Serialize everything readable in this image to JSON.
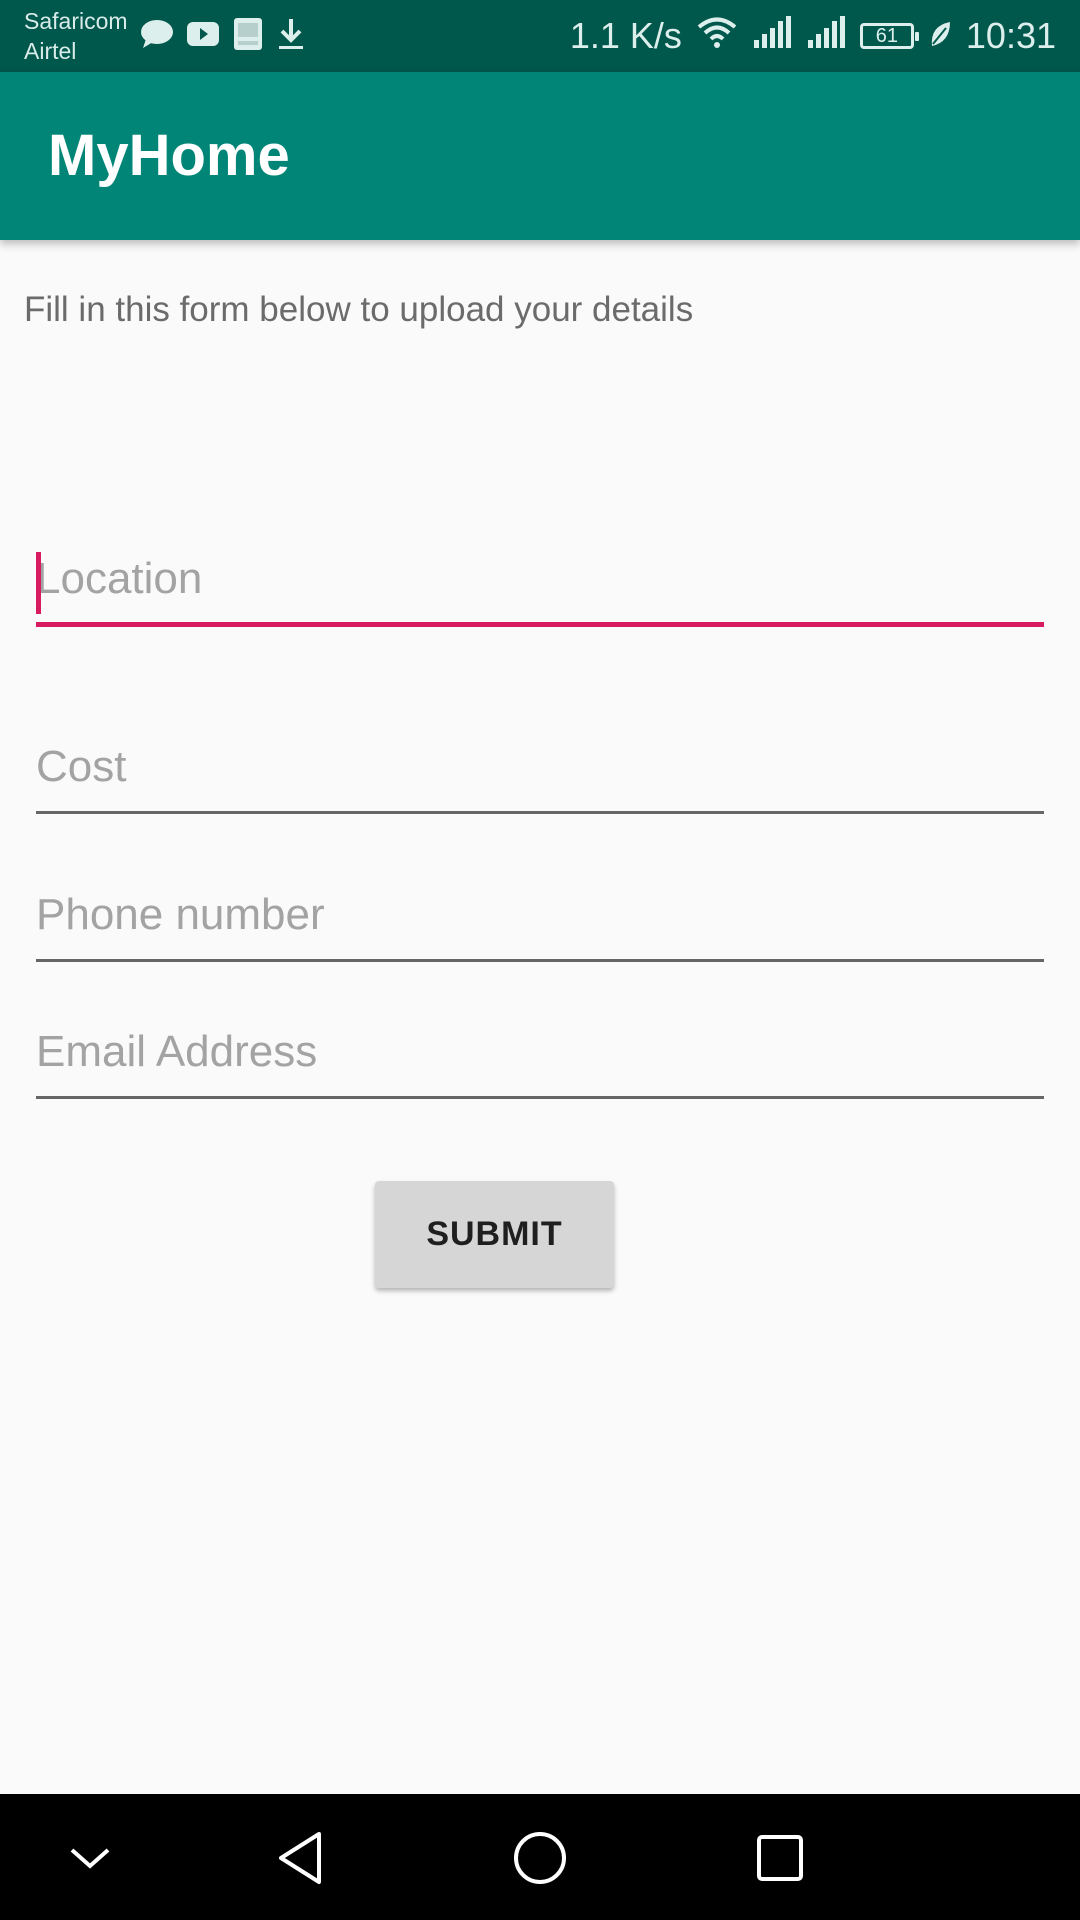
{
  "status_bar": {
    "carrier_1": "Safaricom",
    "carrier_2": "Airtel",
    "net_speed": "1.1 K/s",
    "battery": "61",
    "time": "10:31",
    "icons": [
      "chat-bubble-icon",
      "youtube-icon",
      "bible-app-icon",
      "download-icon",
      "wifi-icon",
      "signal-icon",
      "signal-icon",
      "battery-icon",
      "leaf-icon"
    ]
  },
  "app_bar": {
    "title": "MyHome"
  },
  "form": {
    "intro_text": "Fill in this form below to upload your details",
    "location_placeholder": "Location",
    "cost_placeholder": "Cost",
    "phone_placeholder": "Phone number",
    "email_placeholder": "Email Address",
    "submit_label": "SUBMIT"
  },
  "nav_bar": {
    "icons": [
      "chevron-down-icon",
      "back-icon",
      "home-icon",
      "recents-icon"
    ]
  },
  "colors": {
    "status_bar": "#00574b",
    "app_bar": "#008577",
    "accent": "#d81b60",
    "background": "#fafafa"
  }
}
